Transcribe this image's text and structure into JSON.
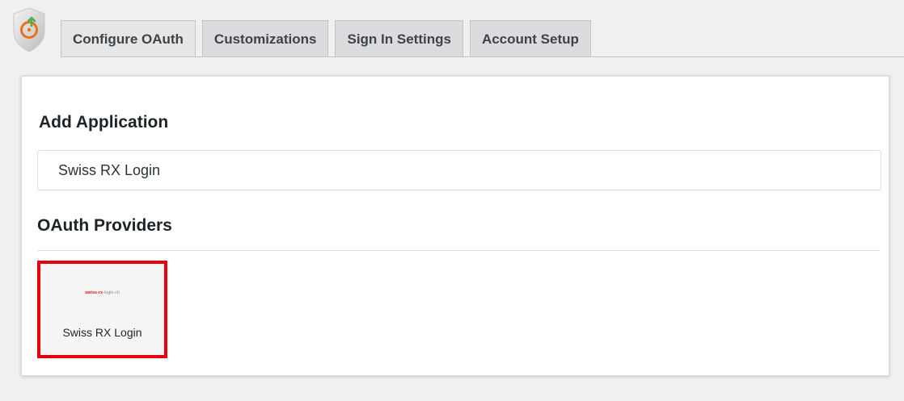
{
  "tabs": [
    {
      "label": "Configure OAuth",
      "active": true
    },
    {
      "label": "Customizations",
      "active": false
    },
    {
      "label": "Sign In Settings",
      "active": false
    },
    {
      "label": "Account Setup",
      "active": false
    }
  ],
  "add_application": {
    "title": "Add Application",
    "input_value": "Swiss RX Login"
  },
  "providers": {
    "title": "OAuth Providers",
    "items": [
      {
        "logo_text_red": "swiss-rx",
        "logo_text_grey": "-login.ch",
        "name": "Swiss RX Login",
        "selected": true
      }
    ]
  },
  "colors": {
    "logo_orange": "#e8711a",
    "logo_green": "#4caf50",
    "selection_red": "#e8000b"
  }
}
